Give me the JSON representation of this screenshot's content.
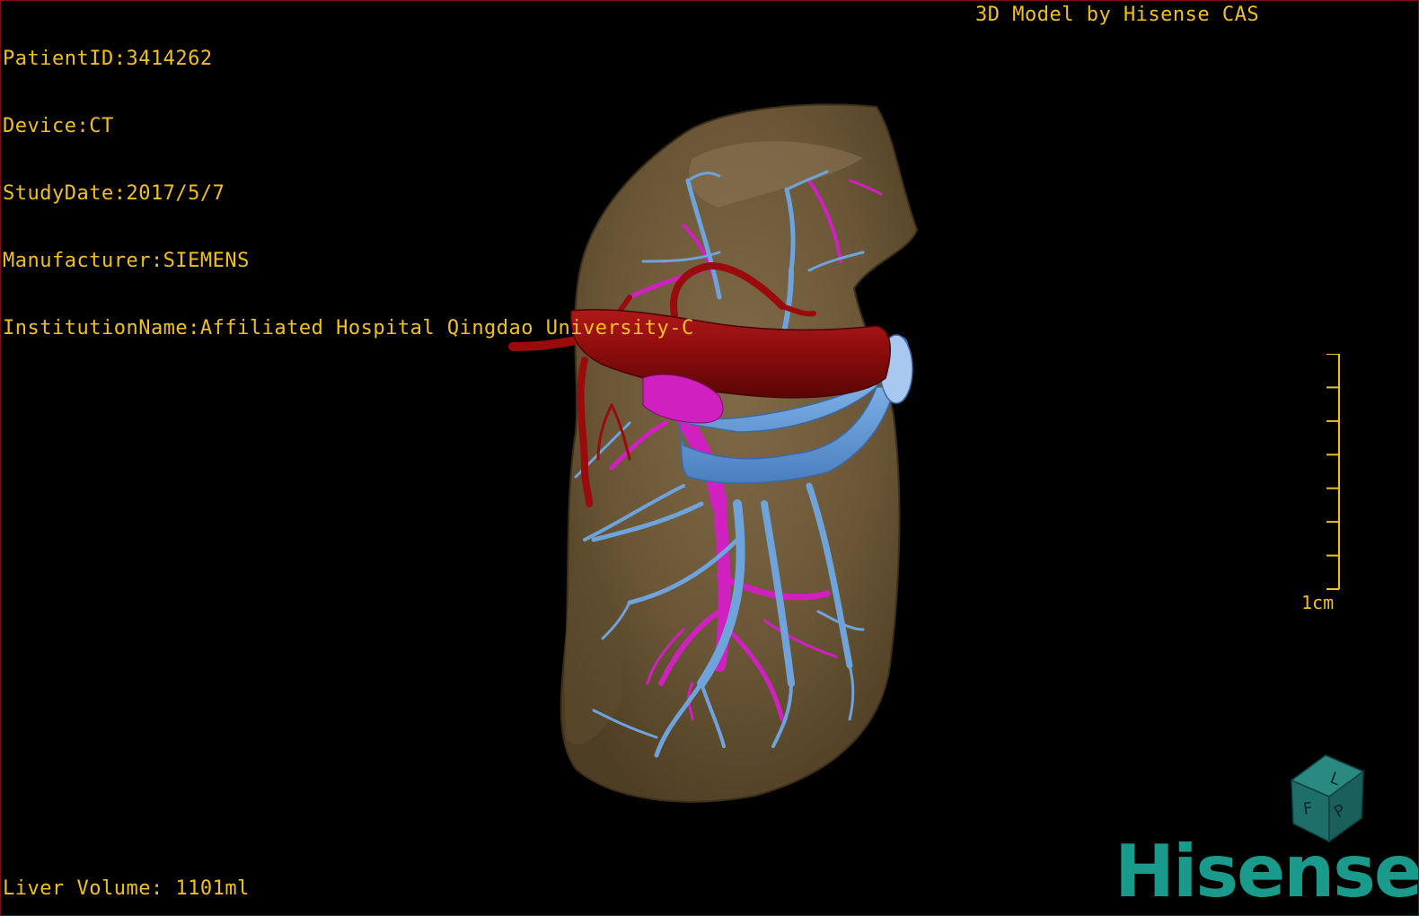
{
  "header": {
    "patient_id": "PatientID:3414262",
    "device": "Device:CT",
    "study_date": "StudyDate:2017/5/7",
    "manufacturer": "Manufacturer:SIEMENS",
    "institution": "InstitutionName:Affiliated Hospital Qingdao University-C"
  },
  "brand_caption": "3D Model by Hisense CAS",
  "scale": {
    "label": "1cm",
    "ticks": 8
  },
  "orientation_cube": {
    "labels": [
      "F",
      "L",
      "P"
    ],
    "color": "#1e6f6a"
  },
  "footer": {
    "liver_volume": "Liver Volume: 1101ml"
  },
  "logo": {
    "text": "Hisense",
    "color": "#1a9a8a"
  },
  "model": {
    "liver_color": "#6e5a3a",
    "hepatic_vein_color": "#6fa3dc",
    "portal_vein_color": "#d020c0",
    "artery_color": "#a01010",
    "overlay_text_color": "#f0c020"
  }
}
